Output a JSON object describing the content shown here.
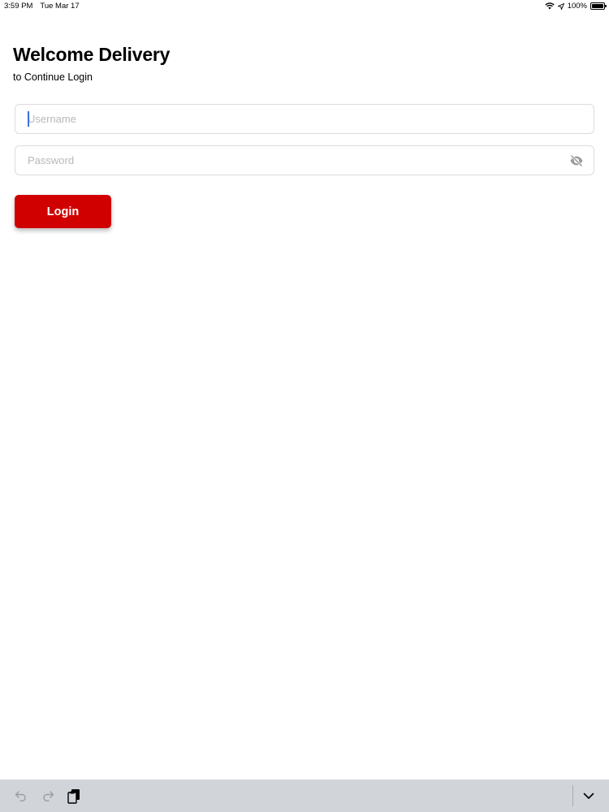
{
  "status_bar": {
    "time": "3:59 PM",
    "date": "Tue Mar 17",
    "battery": "100%",
    "battery_level": 1.0,
    "icons": [
      "wifi-icon",
      "location-arrow-icon",
      "battery-icon"
    ]
  },
  "header": {
    "title": "Welcome Delivery",
    "subtitle": "to Continue Login"
  },
  "form": {
    "username_placeholder": "Username",
    "username_value": "",
    "password_placeholder": "Password",
    "password_value": "",
    "login_label": "Login",
    "password_toggle_icon": "eye-off-icon"
  },
  "keyboard_bar": {
    "icons": [
      "undo-icon",
      "redo-icon",
      "paste-icon",
      "chevron-down-icon"
    ]
  },
  "colors": {
    "accent": "#d10000",
    "caret": "#3f6fe0",
    "keyboard_bar": "#d1d4d9"
  }
}
